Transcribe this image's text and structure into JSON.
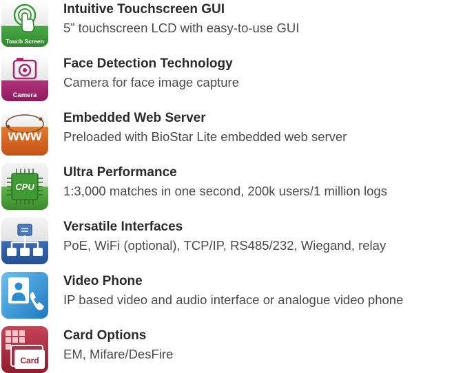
{
  "features": [
    {
      "title": "Intuitive Touchscreen GUI",
      "description": "5” touchscreen LCD with easy-to-use GUI",
      "icon": "touch-screen-icon",
      "icon_label": "Touch Screen",
      "color": "#3d9a3a"
    },
    {
      "title": "Face Detection Technology",
      "description": "Camera for face image capture",
      "icon": "camera-icon",
      "icon_label": "Camera",
      "color": "#a8246e"
    },
    {
      "title": "Embedded Web Server",
      "description": "Preloaded with BioStar Lite embedded web server",
      "icon": "www-icon",
      "icon_label": "www",
      "color": "#d8651c"
    },
    {
      "title": "Ultra Performance",
      "description": "1:3,000 matches in one second, 200k users/1 million logs",
      "icon": "cpu-icon",
      "icon_label": "CPU",
      "color": "#4fa33c"
    },
    {
      "title": "Versatile Interfaces",
      "description": "PoE, WiFi (optional), TCP/IP, RS485/232, Wiegand, relay",
      "icon": "network-icon",
      "icon_label": "",
      "color": "#2f5da8"
    },
    {
      "title": "Video Phone",
      "description": "IP based video and audio interface or analogue video phone",
      "icon": "video-phone-icon",
      "icon_label": "",
      "color": "#2a8fd0"
    },
    {
      "title": "Card Options",
      "description": "EM, Mifare/DesFire",
      "icon": "card-icon",
      "icon_label": "Card",
      "color": "#b02a3c"
    }
  ]
}
